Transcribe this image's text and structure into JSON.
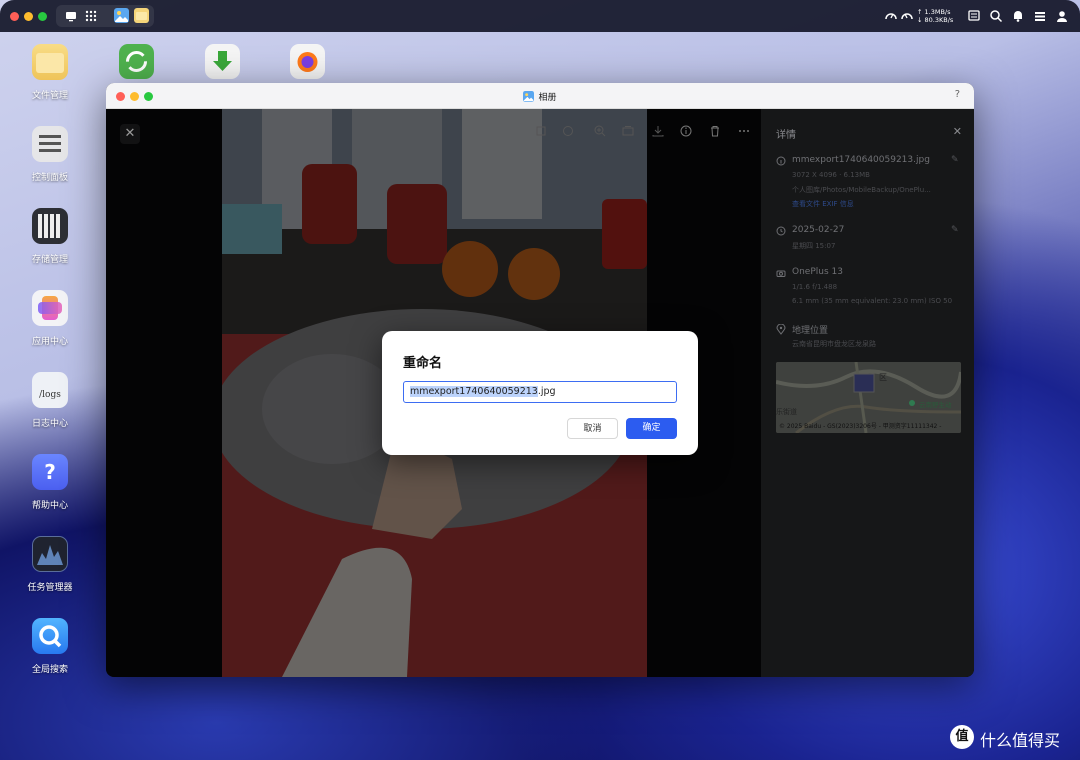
{
  "topbar": {
    "net_up": "↑ 1.3MB/s",
    "net_down": "↓ 80.3KB/s",
    "cpu_label": "CPU",
    "ram_label": "RAM"
  },
  "desktop": {
    "items": [
      {
        "label": "文件管理",
        "icon": "folder-icon"
      },
      {
        "label": "控制面板",
        "icon": "control-panel-icon"
      },
      {
        "label": "存储管理",
        "icon": "storage-icon"
      },
      {
        "label": "应用中心",
        "icon": "app-center-icon"
      },
      {
        "label": "日志中心",
        "icon": "logs-icon",
        "glyph": "/logs"
      },
      {
        "label": "帮助中心",
        "icon": "help-icon",
        "glyph": "?"
      },
      {
        "label": "任务管理器",
        "icon": "task-manager-icon"
      },
      {
        "label": "全局搜索",
        "icon": "search-app-icon"
      }
    ]
  },
  "window": {
    "title": "相册",
    "help": "?"
  },
  "details": {
    "header": "详情",
    "file": {
      "name": "mmexport1740640059213.jpg",
      "size": "3072 X 4096 · 6.13MB",
      "path": "个人图库/Photos/MobileBackup/OnePlu...",
      "exif_link": "查看文件 EXIF 信息"
    },
    "date": {
      "date": "2025-02-27",
      "time": "星期四 15:07"
    },
    "camera": {
      "model": "OnePlus 13",
      "exposure": "1/1.6 f/1.488",
      "lens": "6.1 mm (35 mm equivalent: 23.0 mm) ISO 50"
    },
    "location": {
      "title": "地理位置",
      "address": "云南省昆明市盘龙区龙泉路",
      "map_copyright": "© 2025 Baidu - GS(2023)3206号 - 甲测资字11111342 -",
      "map_poi": "云南野生动",
      "map_district": "区",
      "map_street": "乐街道"
    }
  },
  "dialog": {
    "title": "重命名",
    "input_selected": "mmexport1740640059213",
    "input_ext": ".jpg",
    "cancel": "取消",
    "ok": "确定"
  },
  "watermark": {
    "text": "什么值得买",
    "logo": "值"
  },
  "colors": {
    "accent": "#2c5cf0",
    "selection": "#bcd3fb",
    "panel_bg": "#161718"
  }
}
